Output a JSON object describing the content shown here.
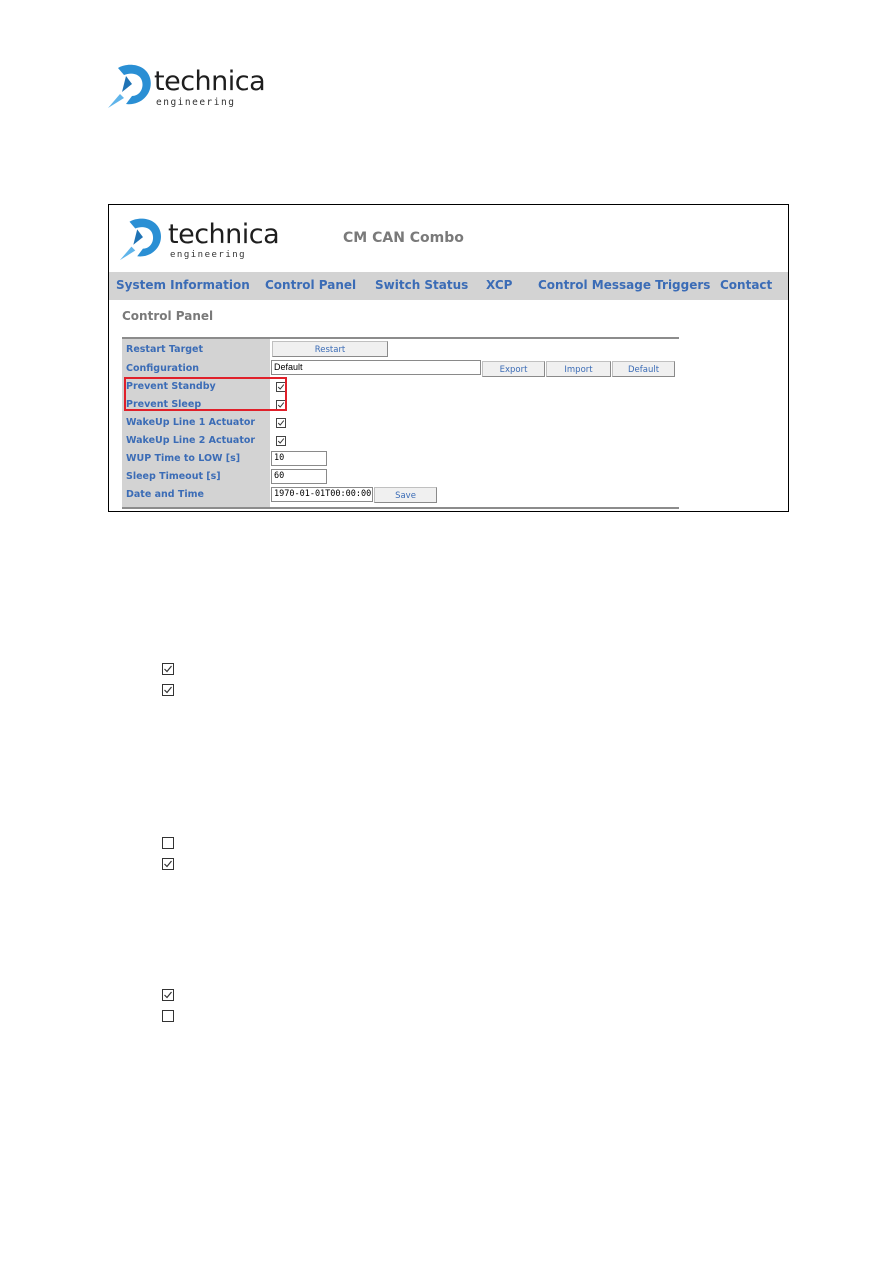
{
  "page_logo": {
    "wordmark": "technica",
    "subtitle": "engineering",
    "brand_color": "#2a8fd4"
  },
  "screenshot": {
    "app_logo": {
      "wordmark": "technica",
      "subtitle": "engineering"
    },
    "app_title": "CM CAN Combo",
    "nav": [
      {
        "label": "System Information"
      },
      {
        "label": "Control Panel"
      },
      {
        "label": "Switch Status"
      },
      {
        "label": "XCP"
      },
      {
        "label": "Control Message Triggers"
      },
      {
        "label": "Contact"
      }
    ],
    "section_title": "Control Panel",
    "rows": {
      "restart_target": {
        "label": "Restart Target",
        "button": "Restart"
      },
      "configuration": {
        "label": "Configuration",
        "value": "Default",
        "export": "Export",
        "import": "Import",
        "default": "Default"
      },
      "prevent_standby": {
        "label": "Prevent Standby",
        "checked": true
      },
      "prevent_sleep": {
        "label": "Prevent Sleep",
        "checked": true
      },
      "wakeup_line1": {
        "label": "WakeUp Line 1 Actuator",
        "checked": true
      },
      "wakeup_line2": {
        "label": "WakeUp Line 2 Actuator",
        "checked": true
      },
      "wup_time": {
        "label": "WUP Time to LOW [s]",
        "value": "10"
      },
      "sleep_timeout": {
        "label": "Sleep Timeout [s]",
        "value": "60"
      },
      "date_time": {
        "label": "Date and Time",
        "value": "1970-01-01T00:00:00",
        "button": "Save"
      }
    },
    "highlight_color": "#e0202a",
    "label_color": "#3b6cb6"
  },
  "doc_checkbox_groups": [
    {
      "items": [
        {
          "checked": true
        },
        {
          "checked": true
        }
      ]
    },
    {
      "items": [
        {
          "checked": false
        },
        {
          "checked": true
        }
      ]
    },
    {
      "items": [
        {
          "checked": true
        },
        {
          "checked": false
        }
      ]
    }
  ]
}
